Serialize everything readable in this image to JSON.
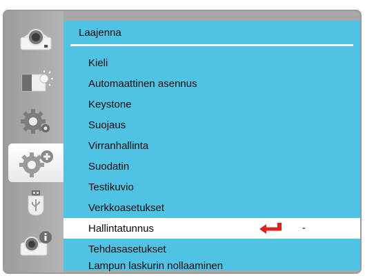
{
  "menu": {
    "title": "Laajenna",
    "items": [
      {
        "label": "Kieli"
      },
      {
        "label": "Automaattinen asennus"
      },
      {
        "label": "Keystone"
      },
      {
        "label": "Suojaus"
      },
      {
        "label": "Virranhallinta"
      },
      {
        "label": "Suodatin"
      },
      {
        "label": "Testikuvio"
      },
      {
        "label": "Verkkoasetukset"
      },
      {
        "label": "Hallintatunnus",
        "value": "-",
        "selected": true
      },
      {
        "label": "Tehdasasetukset"
      },
      {
        "label": "Lampun laskurin nollaaminen"
      }
    ]
  },
  "sidebar": {
    "items": [
      {
        "icon": "projector-icon"
      },
      {
        "icon": "picture-brightness-icon"
      },
      {
        "icon": "gear-icon"
      },
      {
        "icon": "expand-settings-icon",
        "active": true
      },
      {
        "icon": "usb-icon"
      },
      {
        "icon": "projector-info-icon"
      }
    ]
  },
  "colors": {
    "panel": "#4fc3e3",
    "selected_row": "#ffffff",
    "enter_arrow": "#e0201b",
    "sidebar": "#a8a8a8"
  }
}
